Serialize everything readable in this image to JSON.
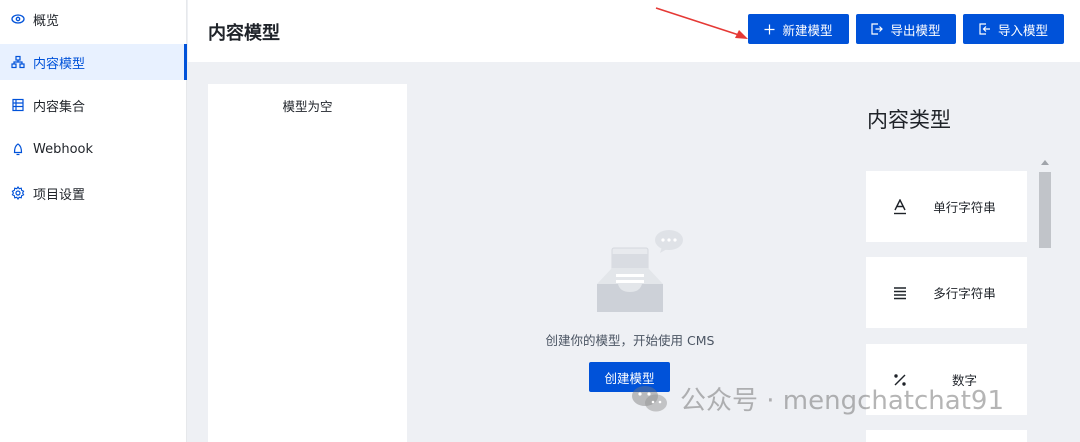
{
  "sidebar": {
    "items": [
      {
        "label": "概览",
        "icon": "eye-icon"
      },
      {
        "label": "内容模型",
        "icon": "model-icon"
      },
      {
        "label": "内容集合",
        "icon": "collection-icon"
      },
      {
        "label": "Webhook",
        "icon": "webhook-icon"
      },
      {
        "label": "项目设置",
        "icon": "gear-icon"
      }
    ],
    "active_index": 1
  },
  "header": {
    "title": "内容模型",
    "new_model_label": "新建模型",
    "export_label": "导出模型",
    "import_label": "导入模型"
  },
  "model_list": {
    "empty_text": "模型为空"
  },
  "empty_state": {
    "message": "创建你的模型，开始使用 CMS",
    "create_button": "创建模型"
  },
  "content_types": {
    "title": "内容类型",
    "items": [
      {
        "label": "单行字符串",
        "icon": "single-line-text-icon"
      },
      {
        "label": "多行字符串",
        "icon": "multi-line-text-icon"
      },
      {
        "label": "数字",
        "icon": "number-icon"
      }
    ]
  },
  "watermark": {
    "text": "公众号 · mengchatchat91"
  },
  "colors": {
    "primary": "#0052d9",
    "sidebar_active_bg": "#e8f1ff",
    "page_bg": "#eef0f4",
    "arrow": "#e53935"
  }
}
